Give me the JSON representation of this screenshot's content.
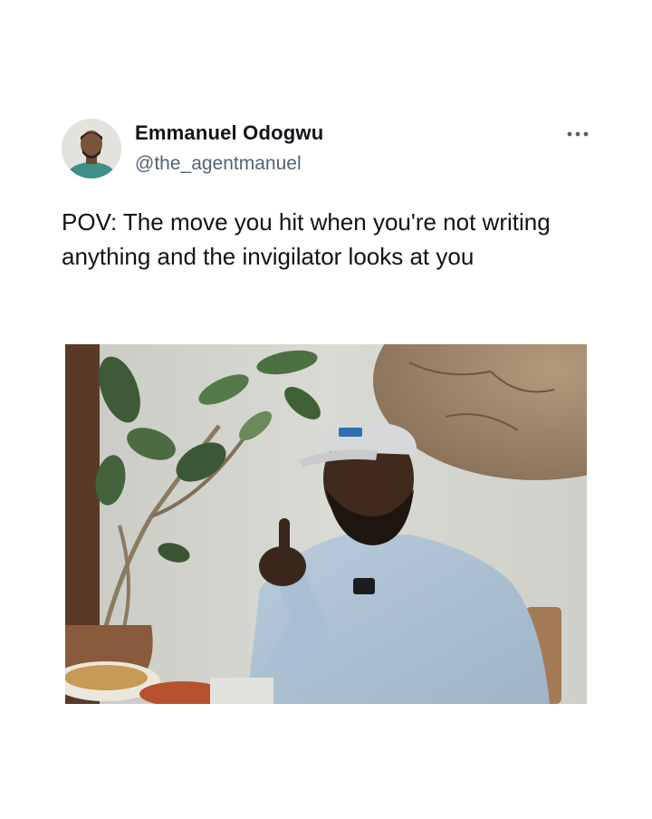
{
  "tweet": {
    "author": {
      "display_name": "Emmanuel Odogwu",
      "handle": "@the_agentmanuel",
      "avatar_icon": "profile-photo"
    },
    "more_icon": "more-horizontal-icon",
    "text": "POV: The move you hit when you're not writing anything and the invigilator looks at you",
    "media": {
      "type": "video-still",
      "description_icon": "photo"
    }
  },
  "colors": {
    "text_primary": "#0f1419",
    "text_secondary": "#536471",
    "background": "#ffffff"
  }
}
